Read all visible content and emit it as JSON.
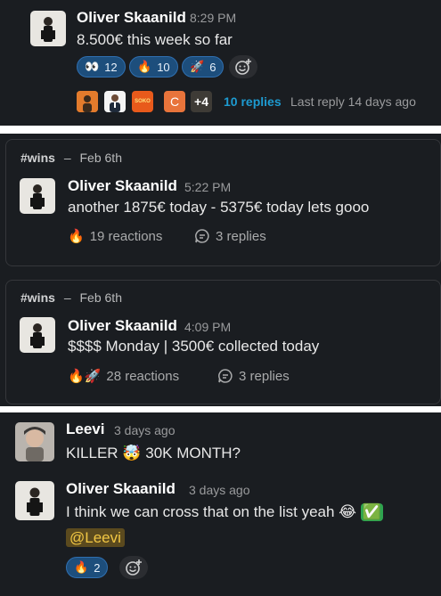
{
  "panel1": {
    "author": "Oliver Skaanild",
    "time": "8:29 PM",
    "message": "8.500€ this week so far",
    "reactions": [
      {
        "emoji": "👀",
        "count": "12"
      },
      {
        "emoji": "🔥",
        "count": "10"
      },
      {
        "emoji": "🚀",
        "count": "6"
      }
    ],
    "add_reaction_icon": "add-emoji-icon",
    "thread": {
      "more_count": "+4",
      "chip_c_label": "C",
      "chip_orange_label": "SOKO",
      "replies": "10 replies",
      "last_reply": "Last reply 14 days ago"
    }
  },
  "card1": {
    "channel_hash": "#",
    "channel": "wins",
    "dash": "–",
    "date": "Feb 6th",
    "author": "Oliver Skaanild",
    "time": "5:22 PM",
    "message": "another 1875€ today - 5375€ today lets gooo",
    "reaction_emoji": "🔥",
    "reactions_text": "19 reactions",
    "replies_text": "3 replies"
  },
  "card2": {
    "channel_hash": "#",
    "channel": "wins",
    "dash": "–",
    "date": "Feb 6th",
    "author": "Oliver Skaanild",
    "time": "4:09 PM",
    "message": "$$$$ Monday | 3500€ collected today",
    "reaction_emojis": "🔥🚀",
    "reactions_text": "28 reactions",
    "replies_text": "3 replies"
  },
  "panel3": {
    "msg1": {
      "author": "Leevi",
      "time": "3 days ago",
      "text_before": "KILLER",
      "emoji": "🤯",
      "text_after": "30K MONTH?"
    },
    "msg2": {
      "author": "Oliver Skaanild",
      "time": "3 days ago",
      "text": "I think we can cross that on the list yeah",
      "emoji1": "😂",
      "emoji2": "✅",
      "mention": "@Leevi",
      "reaction": {
        "emoji": "🔥",
        "count": "2"
      }
    }
  },
  "colors": {
    "background": "#1a1d21",
    "reaction_bg": "#1d4e7c",
    "link": "#1d9bd1",
    "mention_bg": "#5b4a1e",
    "mention_text": "#f2c744"
  }
}
